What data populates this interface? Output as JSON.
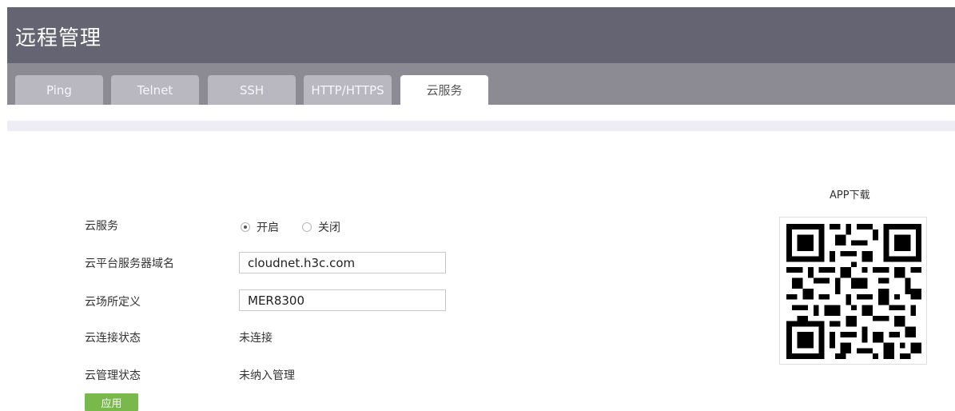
{
  "header": {
    "title": "远程管理"
  },
  "tabs": [
    {
      "label": "Ping",
      "active": false
    },
    {
      "label": "Telnet",
      "active": false
    },
    {
      "label": "SSH",
      "active": false
    },
    {
      "label": "HTTP/HTTPS",
      "active": false
    },
    {
      "label": "云服务",
      "active": true
    }
  ],
  "form": {
    "cloud_service": {
      "label": "云服务",
      "options": [
        {
          "label": "开启",
          "checked": true
        },
        {
          "label": "关闭",
          "checked": false
        }
      ]
    },
    "server_domain": {
      "label": "云平台服务器域名",
      "value": "cloudnet.h3c.com"
    },
    "site_name": {
      "label": "云场所定义",
      "value": "MER8300"
    },
    "connect_status": {
      "label": "云连接状态",
      "value": "未连接"
    },
    "manage_status": {
      "label": "云管理状态",
      "value": "未纳入管理"
    },
    "apply_label": "应用"
  },
  "app_download": {
    "label": "APP下载",
    "icon": "qr-code-icon"
  },
  "colors": {
    "header_bg": "#646472",
    "tabbar_bg": "#8c8b94",
    "tab_bg": "#b9b8c0",
    "apply_button": "#79b84b"
  }
}
